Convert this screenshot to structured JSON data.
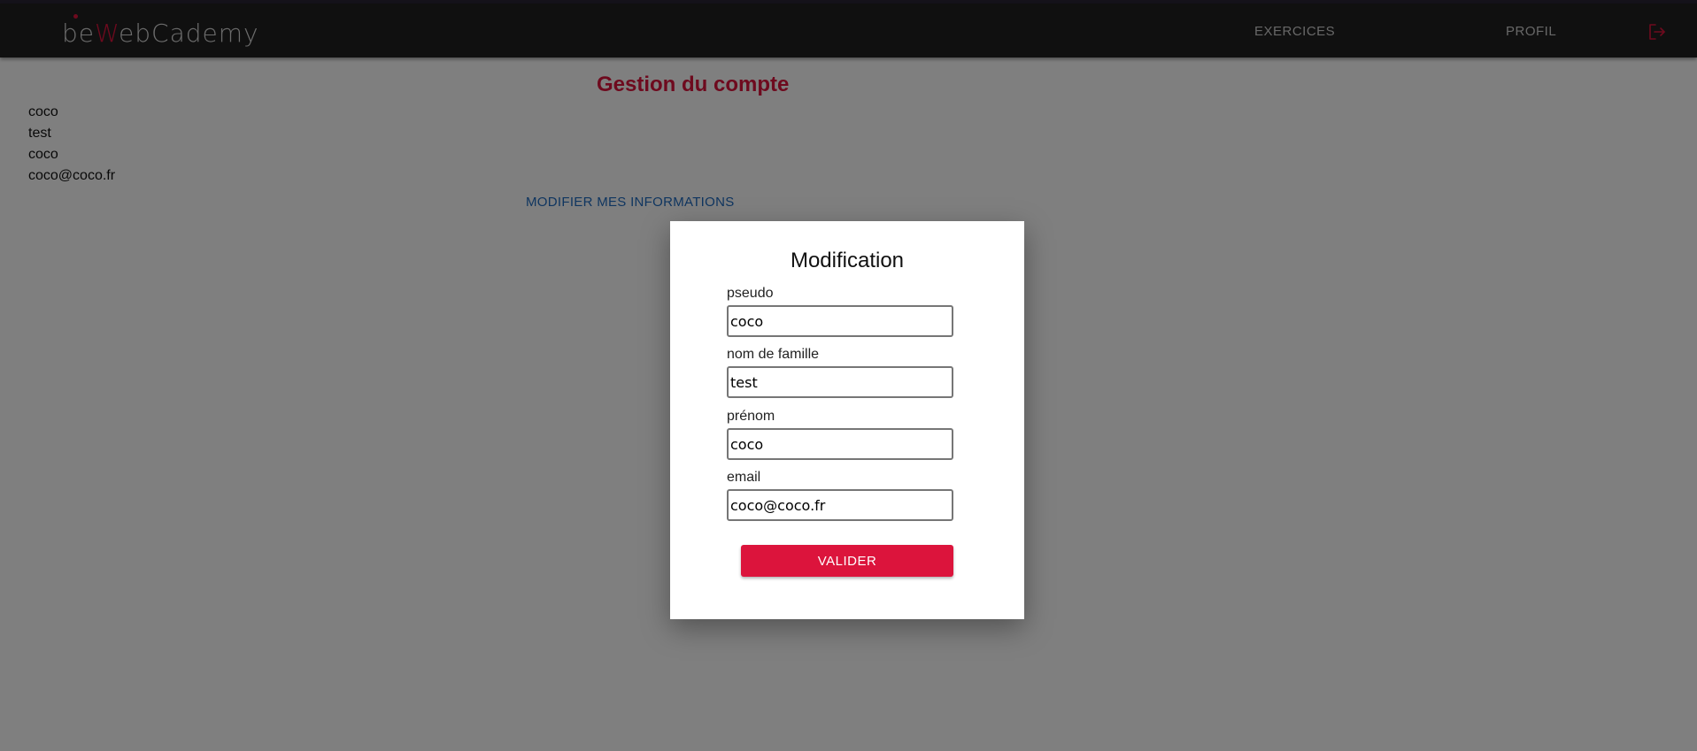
{
  "app": {
    "logo_prefix": "be",
    "logo_accent": "W",
    "logo_suffix": "ebCademy"
  },
  "nav": {
    "exercices_label": "EXERCICES",
    "profil_label": "PROFIL",
    "logout_icon": "logout-icon"
  },
  "account": {
    "title": "Gestion du compte",
    "info": [
      "coco",
      "test",
      "coco",
      "coco@coco.fr"
    ],
    "modify_label": "MODIFIER MES INFORMATIONS"
  },
  "modal": {
    "title": "Modification",
    "fields": {
      "pseudo": {
        "label": "pseudo",
        "value": "coco"
      },
      "nom": {
        "label": "nom de famille",
        "value": "test"
      },
      "prenom": {
        "label": "prénom",
        "value": "coco"
      },
      "email": {
        "label": "email",
        "value": "coco@coco.fr"
      }
    },
    "submit_label": "VALIDER"
  },
  "colors": {
    "accent": "#dc143c",
    "navbar": "#212121",
    "link": "#1e6bc0",
    "overlay": "rgba(0,0,0,0.5)"
  }
}
